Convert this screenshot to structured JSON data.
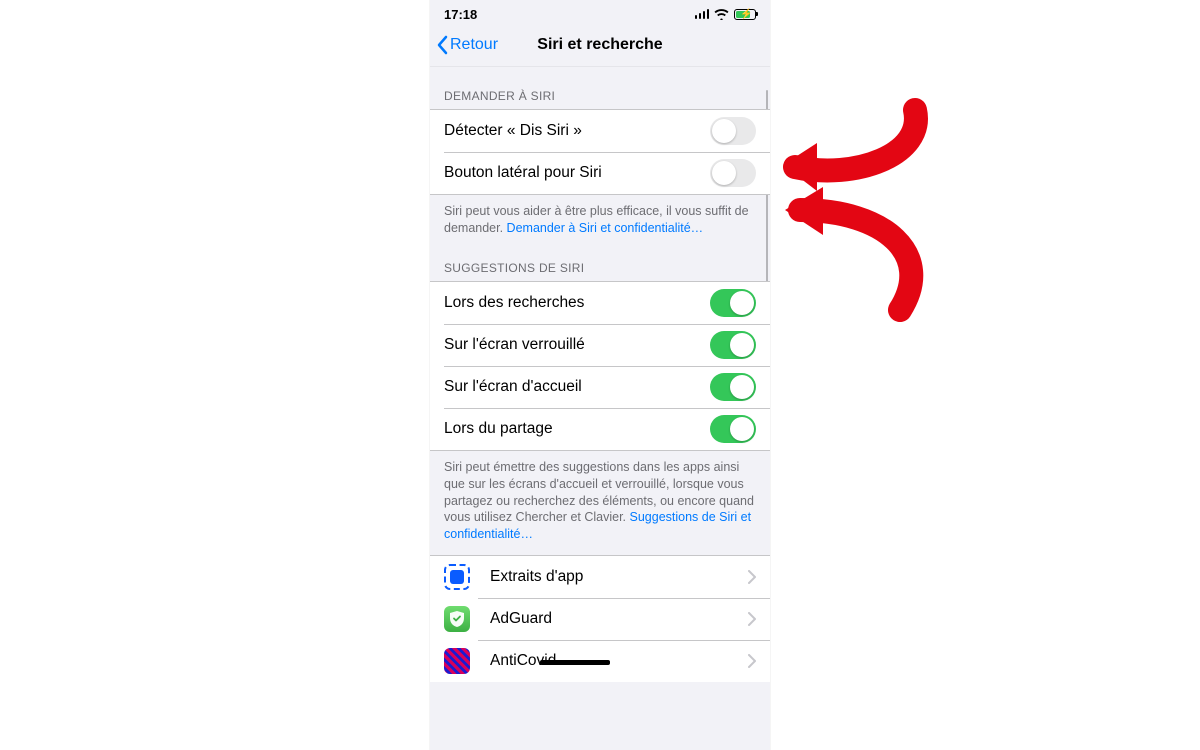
{
  "status_bar": {
    "time": "17:18"
  },
  "nav": {
    "back": "Retour",
    "title": "Siri et recherche"
  },
  "sections": {
    "ask_siri": {
      "header": "DEMANDER À SIRI",
      "rows": [
        {
          "label": "Détecter « Dis Siri »",
          "on": false
        },
        {
          "label": "Bouton latéral pour Siri",
          "on": false
        }
      ],
      "footer_text": "Siri peut vous aider à être plus efficace, il vous suffit de demander. ",
      "footer_link": "Demander à Siri et confidentialité…"
    },
    "suggestions": {
      "header": "SUGGESTIONS DE SIRI",
      "rows": [
        {
          "label": "Lors des recherches",
          "on": true
        },
        {
          "label": "Sur l'écran verrouillé",
          "on": true
        },
        {
          "label": "Sur l'écran d'accueil",
          "on": true
        },
        {
          "label": "Lors du partage",
          "on": true
        }
      ],
      "footer_text": "Siri peut émettre des suggestions dans les apps ainsi que sur les écrans d'accueil et verrouillé, lorsque vous partagez ou recherchez des éléments, ou encore quand vous utilisez Chercher et Clavier. ",
      "footer_link": "Suggestions de Siri et confidentialité…"
    },
    "apps": [
      {
        "label": "Extraits d'app",
        "icon": "app-clips"
      },
      {
        "label": "AdGuard",
        "icon": "adguard"
      },
      {
        "label": "AntiCovid",
        "icon": "anticovid"
      }
    ]
  },
  "annotation": {
    "color": "#e30613"
  }
}
